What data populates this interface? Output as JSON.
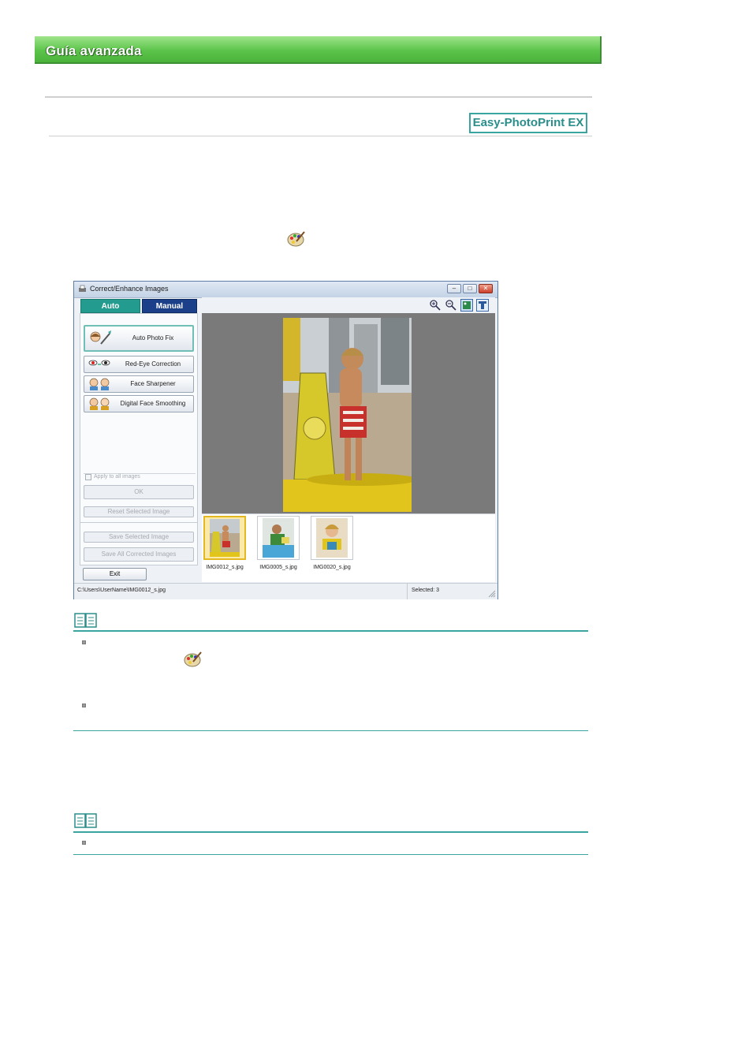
{
  "header": {
    "title": "Guía avanzada"
  },
  "logo": {
    "text": "Easy-PhotoPrint EX"
  },
  "window": {
    "title": "Correct/Enhance Images",
    "tabs": [
      {
        "label": "Auto"
      },
      {
        "label": "Manual"
      }
    ],
    "feature_buttons": [
      {
        "label": "Auto Photo Fix",
        "icon": "auto-photo-fix-icon"
      },
      {
        "label": "Red-Eye Correction",
        "icon": "red-eye-icon"
      },
      {
        "label": "Face Sharpener",
        "icon": "face-sharpener-icon"
      },
      {
        "label": "Digital Face Smoothing",
        "icon": "face-smoothing-icon"
      }
    ],
    "apply_all_label": "Apply to all images",
    "ok_label": "OK",
    "reset_label": "Reset Selected Image",
    "save_selected_label": "Save Selected Image",
    "save_all_label": "Save All Corrected Images",
    "exit_label": "Exit",
    "thumbnails": [
      {
        "name": "IMG0012_s.jpg",
        "selected": true
      },
      {
        "name": "IMG0005_s.jpg",
        "selected": false
      },
      {
        "name": "IMG0020_s.jpg",
        "selected": false
      }
    ],
    "status": {
      "path": "C:\\Users\\UserName\\IMG0012_s.jpg",
      "selected": "Selected: 3"
    }
  },
  "colors": {
    "banner": "#5cc44a",
    "accent": "#3aa5a0",
    "tab_auto": "#239b8e",
    "tab_manual": "#1b3f88"
  }
}
